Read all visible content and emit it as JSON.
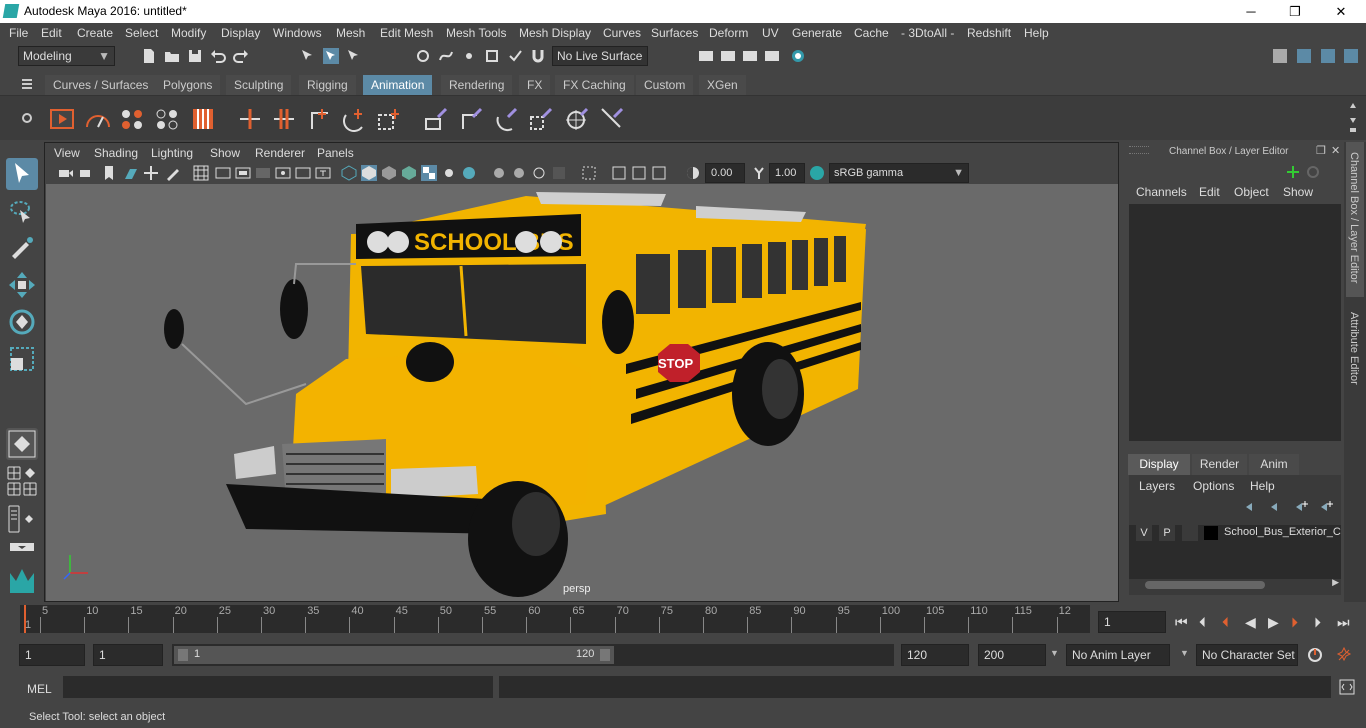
{
  "window": {
    "title": "Autodesk Maya 2016: untitled*",
    "minimize": "─",
    "restore": "❐",
    "close": "✕"
  },
  "menu": [
    "File",
    "Edit",
    "Create",
    "Select",
    "Modify",
    "Display",
    "Windows",
    "Mesh",
    "Edit Mesh",
    "Mesh Tools",
    "Mesh Display",
    "Curves",
    "Surfaces",
    "Deform",
    "UV",
    "Generate",
    "Cache",
    "- 3DtoAll -",
    "Redshift",
    "Help"
  ],
  "statusline": {
    "mode": "Modeling",
    "live_surface": "No Live Surface"
  },
  "shelf_tabs": [
    "Curves / Surfaces",
    "Polygons",
    "Sculpting",
    "Rigging",
    "Animation",
    "Rendering",
    "FX",
    "FX Caching",
    "Custom",
    "XGen"
  ],
  "active_shelf": "Animation",
  "viewport": {
    "menus": [
      "View",
      "Shading",
      "Lighting",
      "Show",
      "Renderer",
      "Panels"
    ],
    "exposure": "0.00",
    "gamma": "1.00",
    "color_space": "sRGB gamma",
    "camera_label": "persp",
    "bus_sign": "SCHOOL BUS",
    "stop_sign": "STOP"
  },
  "channel_box": {
    "title": "Channel Box / Layer Editor",
    "menus": [
      "Channels",
      "Edit",
      "Object",
      "Show"
    ],
    "layer_tabs": [
      "Display",
      "Render",
      "Anim"
    ],
    "active_layer_tab": "Display",
    "layer_menus": [
      "Layers",
      "Options",
      "Help"
    ],
    "layer": {
      "v": "V",
      "p": "P",
      "name": "School_Bus_Exterior_C"
    }
  },
  "side_tabs": [
    "Channel Box / Layer Editor",
    "Attribute Editor"
  ],
  "timeline": {
    "ticks": [
      "5",
      "10",
      "15",
      "20",
      "25",
      "30",
      "35",
      "40",
      "45",
      "50",
      "55",
      "60",
      "65",
      "70",
      "75",
      "80",
      "85",
      "90",
      "95",
      "100",
      "105",
      "110",
      "115",
      "12"
    ],
    "start_marker": "1",
    "current_frame": "1"
  },
  "range": {
    "start": "1",
    "playback_start": "1",
    "slider_start": "1",
    "slider_end": "120",
    "playback_end": "120",
    "end": "200",
    "anim_layer": "No Anim Layer",
    "character_set": "No Character Set"
  },
  "command_line": {
    "label": "MEL"
  },
  "help_line": "Select Tool: select an object"
}
